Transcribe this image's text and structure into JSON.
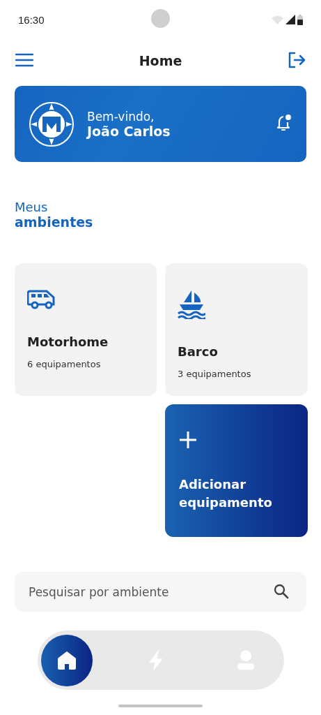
{
  "status_bar": {
    "time": "16:30"
  },
  "header": {
    "title": "Home"
  },
  "banner": {
    "greeting": "Bem-vindo,",
    "name": "João Carlos"
  },
  "section": {
    "title_light": "Meus",
    "title_bold": "ambientes"
  },
  "cards": [
    {
      "kind": "van",
      "title": "Motorhome",
      "subtitle": "6 equipamentos"
    },
    {
      "kind": "boat",
      "title": "Barco",
      "subtitle": "3 equipamentos"
    },
    {
      "kind": "add",
      "title": "Adicionar equipamento"
    }
  ],
  "search": {
    "placeholder": "Pesquisar por ambiente"
  },
  "nav": [
    {
      "kind": "home",
      "selected": true
    },
    {
      "kind": "energy",
      "selected": false
    },
    {
      "kind": "profile",
      "selected": false
    }
  ]
}
